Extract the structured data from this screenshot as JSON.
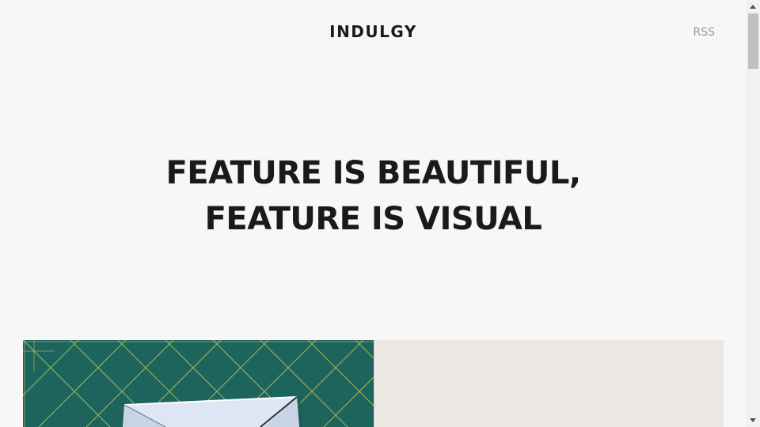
{
  "header": {
    "site_title": "INDULGY",
    "rss_label": "RSS"
  },
  "hero": {
    "line1": "FEATURE IS BEAUTIFUL,",
    "line2": "FEATURE IS VISUAL"
  },
  "gallery": {
    "left_photo": "origami envelope on green cutting mat",
    "right_photo": "white paper background"
  },
  "colors": {
    "background": "#f7f7f7",
    "text": "#1a1a1a",
    "rss": "#9a9a9a",
    "mat_green": "#1f6b62"
  }
}
